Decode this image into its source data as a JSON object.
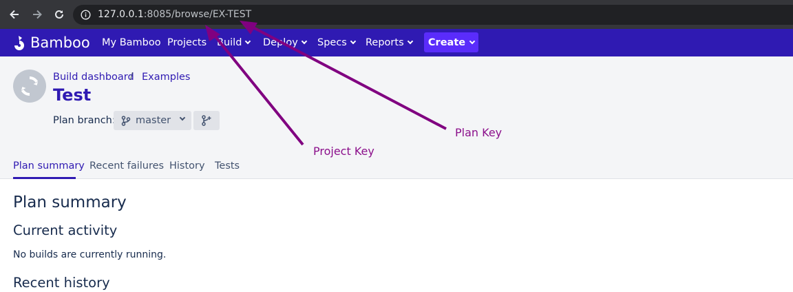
{
  "browser": {
    "url_host": "127.0.0.1",
    "url_rest": ":8085/browse/EX-TEST"
  },
  "app": {
    "logo_text": "Bamboo",
    "nav": [
      "My Bamboo",
      "Projects",
      "Build",
      "Deploy",
      "Specs",
      "Reports"
    ],
    "create_label": "Create",
    "accent": "#2f1ab2",
    "create_color": "#5a2cfb"
  },
  "breadcrumb": {
    "items": [
      "Build dashboard",
      "Examples"
    ],
    "separator": "/"
  },
  "plan": {
    "title": "Test",
    "branch_label": "Plan branch:",
    "branch_value": "master"
  },
  "tabs": [
    "Plan summary",
    "Recent failures",
    "History",
    "Tests"
  ],
  "content": {
    "heading": "Plan summary",
    "current_activity": "Current activity",
    "no_builds": "No builds are currently running.",
    "recent_history": "Recent history"
  },
  "annotations": {
    "project_key": "Project Key",
    "plan_key": "Plan Key",
    "color": "#8b0f8b"
  }
}
